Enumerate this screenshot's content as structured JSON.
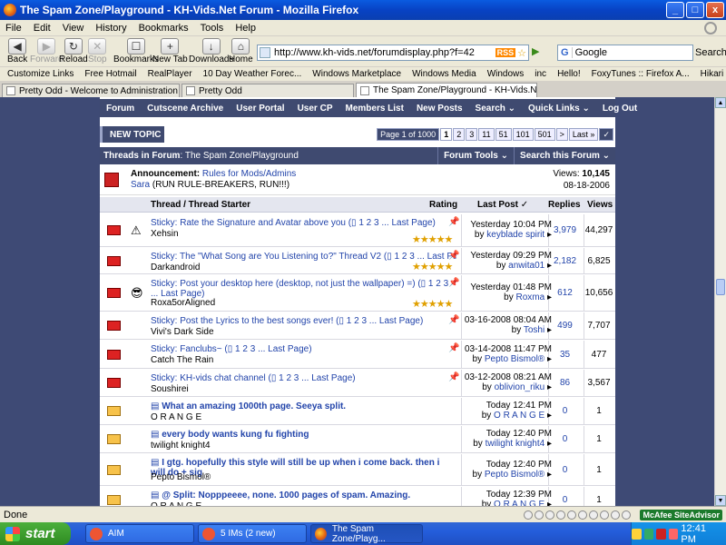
{
  "window": {
    "title": "The Spam Zone/Playground - KH-Vids.Net Forum - Mozilla Firefox",
    "minimize": "_",
    "maximize": "□",
    "close": "x"
  },
  "menu": [
    "File",
    "Edit",
    "View",
    "History",
    "Bookmarks",
    "Tools",
    "Help"
  ],
  "toolbar": {
    "back": "Back",
    "forward": "Forward",
    "reload": "Reload",
    "stop": "Stop",
    "bookmarks": "Bookmarks",
    "new_tab": "New Tab",
    "downloads": "Downloads",
    "home": "Home",
    "url": "http://www.kh-vids.net/forumdisplay.php?f=42",
    "rss": "RSS",
    "search_engine": "G",
    "search_placeholder": "Google",
    "search_button": "Search"
  },
  "bookmarks_bar": [
    "Customize Links",
    "Free Hotmail",
    "RealPlayer",
    "10 Day Weather Forec...",
    "Windows Marketplace",
    "Windows Media",
    "Windows",
    "inc",
    "Hello!",
    "FoxyTunes :: Firefox A...",
    "Hikari (Utada Hikaru so..."
  ],
  "tabs": [
    {
      "label": "Pretty Odd - Welcome to Administration"
    },
    {
      "label": "Pretty Odd"
    },
    {
      "label": "The Spam Zone/Playground - KH-Vids.Ne..."
    }
  ],
  "forum": {
    "nav": [
      "Forum",
      "Cutscene Archive",
      "User Portal",
      "User CP",
      "Members List",
      "New Posts",
      "Search ⌄",
      "Quick Links ⌄",
      "Log Out"
    ],
    "new_topic": "NEW TOPIC",
    "pager": {
      "info": "Page 1 of 1000",
      "pages": [
        "1",
        "2",
        "3",
        "11",
        "51",
        "101",
        "501",
        ">",
        "Last »"
      ],
      "go": "✓"
    },
    "header": {
      "label_prefix": "Threads in Forum",
      "label_forum": ": The Spam Zone/Playground",
      "tools": "Forum Tools ⌄",
      "search": "Search this Forum ⌄"
    },
    "announcement": {
      "label": "Announcement:",
      "title": "Rules for Mods/Admins",
      "author": "Sara",
      "note": "(RUN RULE-BREAKERS, RUN!!!)",
      "views_label": "Views:",
      "views": "10,145",
      "date": "08-18-2006"
    },
    "columns": {
      "thread": "Thread / Thread Starter",
      "rating": "Rating",
      "last_post": "Last Post ✓",
      "replies": "Replies",
      "views": "Views"
    },
    "threads": [
      {
        "title": "Sticky: Rate the Signature and Avatar above you",
        "pages": "1 2 3 ... Last Page",
        "starter": "Xehsin",
        "lp_time": "Yesterday 10:04 PM",
        "lp_by": "keyblade spirit",
        "replies": "3,979",
        "views": "44,297",
        "stars": "★★★★★",
        "prefix": "⚠"
      },
      {
        "title": "Sticky: The \"What Song are You Listening to?\" Thread V2",
        "pages": "1 2 3 ... Last Page",
        "starter": "Darkandroid",
        "lp_time": "Yesterday 09:29 PM",
        "lp_by": "anwita01",
        "replies": "2,182",
        "views": "6,825",
        "stars": "★★★★★",
        "prefix": ""
      },
      {
        "title": "Sticky: Post your desktop here (desktop, not just the wallpaper) =)",
        "pages": "1 2 3 ... Last Page",
        "starter": "Roxa5orAligned",
        "lp_time": "Yesterday 01:48 PM",
        "lp_by": "Roxma",
        "replies": "612",
        "views": "10,656",
        "stars": "★★★★★",
        "prefix": "😎"
      },
      {
        "title": "Sticky: Post the Lyrics to the best songs ever!",
        "pages": "1 2 3 ... Last Page",
        "starter": "Vivi's Dark Side",
        "lp_time": "03-16-2008 08:04 AM",
        "lp_by": "Toshi",
        "replies": "499",
        "views": "7,707",
        "stars": "",
        "prefix": ""
      },
      {
        "title": "Sticky: Fanclubs~",
        "pages": "1 2 3 ... Last Page",
        "starter": "Catch The Rain",
        "lp_time": "03-14-2008 11:47 PM",
        "lp_by": "Pepto Bismol®",
        "replies": "35",
        "views": "477",
        "stars": "",
        "prefix": ""
      },
      {
        "title": "Sticky: KH-vids chat channel",
        "pages": "1 2 3 ... Last Page",
        "starter": "Soushirei",
        "lp_time": "03-12-2008 08:21 AM",
        "lp_by": "oblivion_riku",
        "replies": "86",
        "views": "3,567",
        "stars": "",
        "prefix": ""
      },
      {
        "title": "What an amazing 1000th page. Seeya split.",
        "pages": "",
        "starter": "O R A N G E",
        "lp_time": "Today 12:41 PM",
        "lp_by": "O R A N G E",
        "replies": "0",
        "views": "1",
        "stars": "",
        "prefix": ""
      },
      {
        "title": "every body wants kung fu fighting",
        "pages": "",
        "starter": "twilight knight4",
        "lp_time": "Today 12:40 PM",
        "lp_by": "twilight knight4",
        "replies": "0",
        "views": "1",
        "stars": "",
        "prefix": ""
      },
      {
        "title": "I gtg. hopefully this style will still be up when i come back. then i will do + sig",
        "pages": "",
        "starter": "Pepto Bismol®",
        "lp_time": "Today 12:40 PM",
        "lp_by": "Pepto Bismol®",
        "replies": "0",
        "views": "1",
        "stars": "",
        "prefix": ""
      },
      {
        "title": "@ Split: Nopppeeee, none. 1000 pages of spam. Amazing.",
        "pages": "",
        "starter": "O R A N G E",
        "lp_time": "Today 12:39 PM",
        "lp_by": "O R A N G E",
        "replies": "0",
        "views": "1",
        "stars": "",
        "prefix": ""
      }
    ]
  },
  "status": {
    "text": "Done",
    "mcafee": "McAfee SiteAdvisor"
  },
  "taskbar": {
    "start": "start",
    "items": [
      "AIM",
      "5 IMs (2 new)",
      "The Spam Zone/Playg..."
    ],
    "clock": "12:41 PM"
  },
  "colors": {
    "forum_nav": "#3f4a70",
    "page_bg": "#3e4a75",
    "link": "#2244aa"
  }
}
